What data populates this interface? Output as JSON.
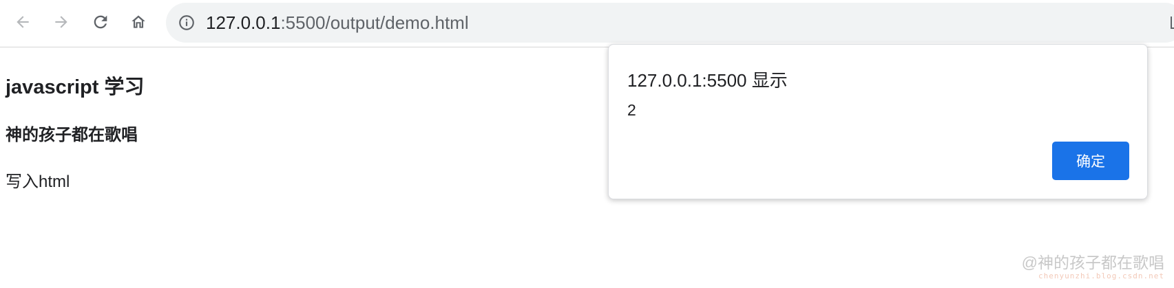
{
  "toolbar": {
    "back_icon": "arrow-left-icon",
    "forward_icon": "arrow-right-icon",
    "reload_icon": "reload-icon",
    "home_icon": "home-icon",
    "site_info_icon": "info-circle-icon",
    "url_host": "127.0.0.1",
    "url_rest": ":5500/output/demo.html"
  },
  "page": {
    "h1": "javascript 学习",
    "h2": "神的孩子都在歌唱",
    "p": "写入html"
  },
  "dialog": {
    "title": "127.0.0.1:5500 显示",
    "message": "2",
    "ok_label": "确定",
    "button_color": "#1a73e8"
  },
  "watermark": {
    "main": "@神的孩子都在歌唱",
    "sub": "chenyunzhi.blog.csdn.net"
  }
}
